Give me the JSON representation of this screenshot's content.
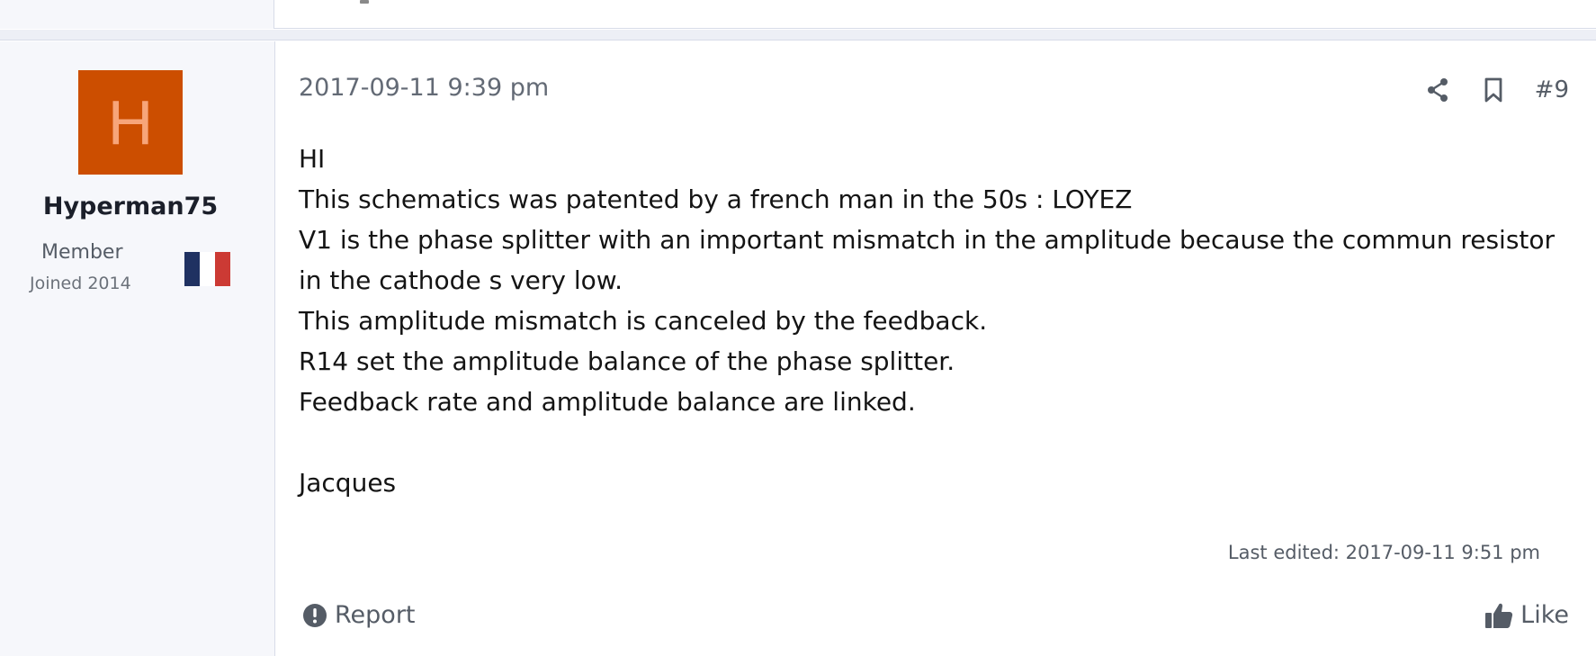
{
  "author": {
    "avatar_letter": "H",
    "avatar_color": "#cc4e00",
    "username": "Hyperman75",
    "title": "Member",
    "joined": "Joined 2014",
    "flag": "france-flag-icon"
  },
  "post": {
    "date": "2017-09-11 9:39 pm",
    "number": "#9",
    "lines": [
      "HI",
      "This schematics was patented by a french man in the 50s : LOYEZ",
      "V1 is the phase splitter with an important mismatch in the amplitude because the commun resistor",
      "in the cathode s very low.",
      "This amplitude mismatch is canceled by the feedback.",
      "R14 set the amplitude balance of the phase splitter.",
      "Feedback rate and amplitude balance are linked.",
      "",
      "Jacques"
    ],
    "last_edited": "Last edited: 2017-09-11 9:51 pm"
  },
  "actions": {
    "share_icon": "share-icon",
    "bookmark_icon": "bookmark-icon",
    "report_label": "Report",
    "like_label": "Like"
  }
}
